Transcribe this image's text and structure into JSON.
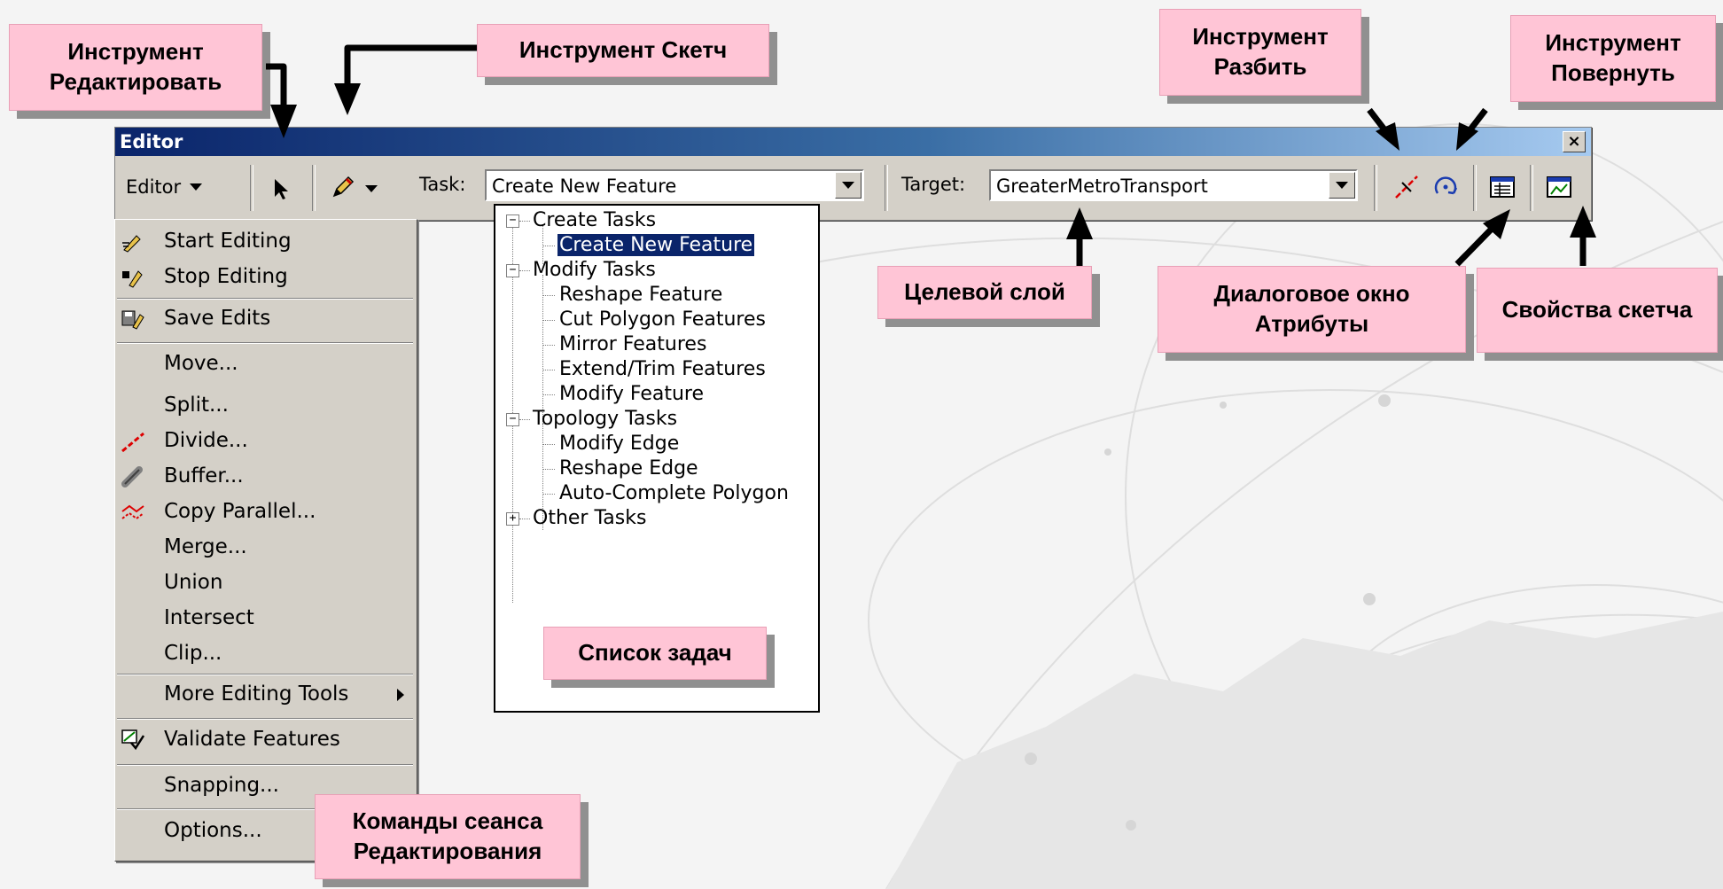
{
  "window": {
    "title": "Editor",
    "close_glyph": "×"
  },
  "toolbar": {
    "editor_menu_label": "Editor",
    "task_label": "Task:",
    "task_value": "Create New Feature",
    "target_label": "Target:",
    "target_value": "GreaterMetroTransport",
    "icons": [
      "edit-tool-arrow-icon",
      "sketch-pencil-icon",
      "split-tool-icon",
      "rotate-tool-icon",
      "attributes-icon",
      "sketch-properties-icon"
    ]
  },
  "editor_menu": {
    "items": [
      {
        "label": "Start Editing",
        "icon": "start-editing-icon"
      },
      {
        "label": "Stop Editing",
        "icon": "stop-editing-icon"
      },
      {
        "label": "Save Edits",
        "icon": "save-edits-icon"
      },
      {
        "label": "Move..."
      },
      {
        "label": "Split..."
      },
      {
        "label": "Divide...",
        "icon": "divide-icon"
      },
      {
        "label": "Buffer...",
        "icon": "buffer-icon"
      },
      {
        "label": "Copy Parallel...",
        "icon": "copy-parallel-icon"
      },
      {
        "label": "Merge..."
      },
      {
        "label": "Union"
      },
      {
        "label": "Intersect"
      },
      {
        "label": "Clip..."
      },
      {
        "label": "More Editing Tools"
      },
      {
        "label": "Validate Features",
        "icon": "validate-features-icon"
      },
      {
        "label": "Snapping..."
      },
      {
        "label": "Options..."
      }
    ]
  },
  "task_tree": {
    "groups": [
      {
        "label": "Create Tasks",
        "expanded": true,
        "items": [
          "Create New Feature"
        ]
      },
      {
        "label": "Modify Tasks",
        "expanded": true,
        "items": [
          "Reshape Feature",
          "Cut Polygon Features",
          "Mirror Features",
          "Extend/Trim Features",
          "Modify Feature"
        ]
      },
      {
        "label": "Topology Tasks",
        "expanded": true,
        "items": [
          "Modify Edge",
          "Reshape Edge",
          "Auto-Complete Polygon"
        ]
      },
      {
        "label": "Other Tasks",
        "expanded": false,
        "items": []
      }
    ],
    "selected": "Create New Feature",
    "expanded_glyph": "−",
    "collapsed_glyph": "+"
  },
  "callouts": {
    "edit_tool": "Инструмент Редактировать",
    "sketch_tool": "Инструмент Скетч",
    "split_tool": "Инструмент Разбить",
    "rotate_tool": "Инструмент Повернуть",
    "target_layer": "Целевой слой",
    "attributes_dialog": "Диалоговое окно Атрибуты",
    "sketch_properties": "Свойства скетча",
    "task_list": "Список задач",
    "session_commands": "Команды сеанса Редактирования"
  },
  "colors": {
    "callout_bg": "#ffc5d6",
    "callout_shadow": "#909090",
    "titlebar_start": "#0a246a",
    "titlebar_end": "#a6caf0",
    "selection": "#0a246a"
  }
}
